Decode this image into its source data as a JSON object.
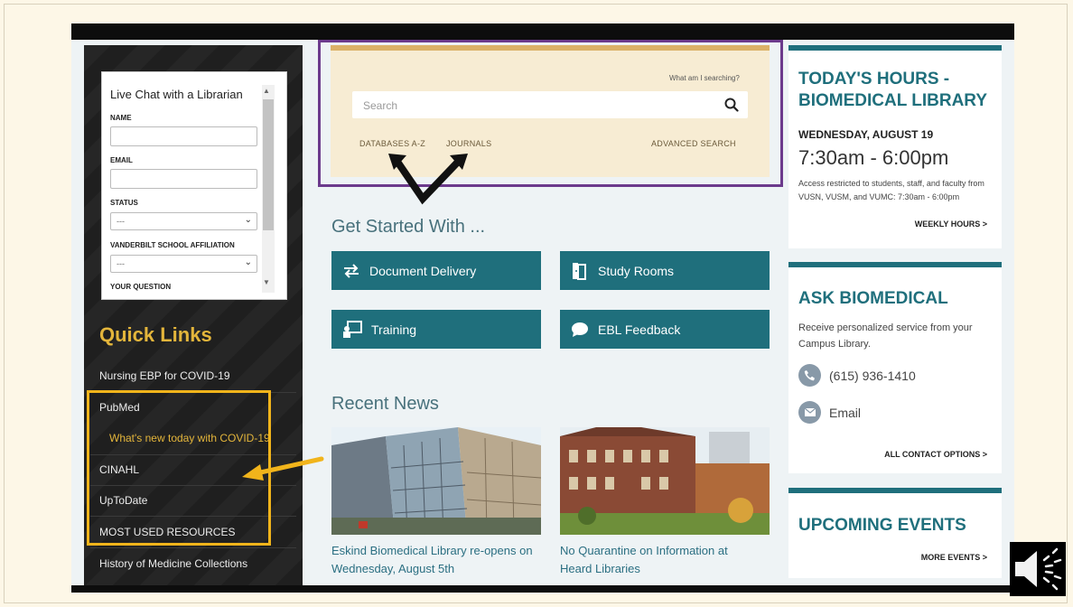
{
  "chat": {
    "title": "Live Chat with a Librarian",
    "name_label": "NAME",
    "email_label": "EMAIL",
    "status_label": "STATUS",
    "status_value": "---",
    "affiliation_label": "VANDERBILT SCHOOL AFFILIATION",
    "affiliation_value": "---",
    "question_label": "YOUR QUESTION"
  },
  "quick_links": {
    "title": "Quick Links",
    "items": [
      "Nursing EBP for COVID-19",
      "PubMed",
      "What's new today with COVID-19",
      "CINAHL",
      "UpToDate",
      "MOST USED RESOURCES",
      "History of Medicine Collections"
    ]
  },
  "search": {
    "what_link": "What am I searching?",
    "placeholder": "Search",
    "links": {
      "databases": "DATABASES A-Z",
      "journals": "JOURNALS",
      "advanced": "ADVANCED SEARCH"
    }
  },
  "get_started": {
    "title": "Get Started With ...",
    "tiles": [
      {
        "label": "Document Delivery",
        "icon": "swap-arrows-icon"
      },
      {
        "label": "Study Rooms",
        "icon": "door-icon"
      },
      {
        "label": "Training",
        "icon": "presentation-icon"
      },
      {
        "label": "EBL Feedback",
        "icon": "chat-bubble-icon"
      }
    ]
  },
  "news": {
    "title": "Recent News",
    "items": [
      {
        "caption": "Eskind Biomedical Library re-opens on Wednesday, August 5th"
      },
      {
        "caption": "No Quarantine on Information at Heard Libraries"
      }
    ]
  },
  "hours": {
    "title": "TODAY'S HOURS - BIOMEDICAL LIBRARY",
    "date": "WEDNESDAY, AUGUST 19",
    "time": "7:30am - 6:00pm",
    "note": "Access restricted to students, staff, and faculty from VUSN, VUSM, and VUMC: 7:30am - 6:00pm",
    "link": "WEEKLY HOURS >"
  },
  "ask": {
    "title": "ASK BIOMEDICAL",
    "desc": "Receive personalized service from your Campus Library.",
    "phone": "(615) 936-1410",
    "email": "Email",
    "link": "ALL CONTACT OPTIONS >"
  },
  "events": {
    "title": "UPCOMING EVENTS",
    "link": "MORE EVENTS >"
  },
  "colors": {
    "teal": "#1f6f7c",
    "gold": "#e3b53b",
    "highlight_yellow": "#f1b41b",
    "purple_outline": "#6c3a8c",
    "search_panel": "#f7ecd3"
  }
}
